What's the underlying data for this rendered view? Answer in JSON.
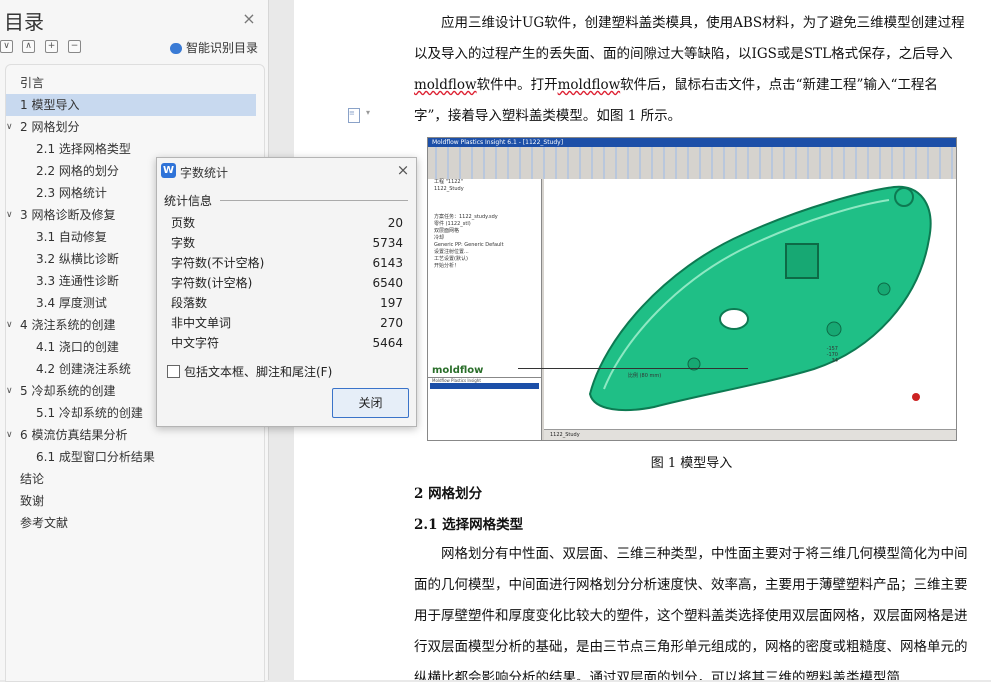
{
  "toc": {
    "title": "目录",
    "close_glyph": "×",
    "tools": [
      "∨",
      "∧",
      "+",
      "−"
    ],
    "smart_label": "智能识别目录",
    "items": [
      {
        "label": "引言",
        "level": 1,
        "caret": ""
      },
      {
        "label": "1 模型导入",
        "level": 1,
        "caret": "",
        "selected": true
      },
      {
        "label": "2 网格划分",
        "level": 1,
        "caret": "∨"
      },
      {
        "label": "2.1  选择网格类型",
        "level": 2,
        "caret": ""
      },
      {
        "label": "2.2 网格的划分",
        "level": 2,
        "caret": ""
      },
      {
        "label": "2.3 网格统计",
        "level": 2,
        "caret": ""
      },
      {
        "label": "3 网格诊断及修复",
        "level": 1,
        "caret": "∨"
      },
      {
        "label": "3.1 自动修复",
        "level": 2,
        "caret": ""
      },
      {
        "label": "3.2 纵横比诊断",
        "level": 2,
        "caret": ""
      },
      {
        "label": "3.3 连通性诊断",
        "level": 2,
        "caret": ""
      },
      {
        "label": "3.4 厚度测试",
        "level": 2,
        "caret": ""
      },
      {
        "label": "4 浇注系统的创建",
        "level": 1,
        "caret": "∨"
      },
      {
        "label": "4.1 浇口的创建",
        "level": 2,
        "caret": ""
      },
      {
        "label": "4.2 创建浇注系统",
        "level": 2,
        "caret": ""
      },
      {
        "label": "5 冷却系统的创建",
        "level": 1,
        "caret": "∨"
      },
      {
        "label": "5.1 冷却系统的创建",
        "level": 2,
        "caret": ""
      },
      {
        "label": "6 模流仿真结果分析",
        "level": 1,
        "caret": "∨"
      },
      {
        "label": "6.1 成型窗口分析结果",
        "level": 2,
        "caret": ""
      },
      {
        "label": "结论",
        "level": 1,
        "caret": ""
      },
      {
        "label": "致谢",
        "level": 1,
        "caret": ""
      },
      {
        "label": "参考文献",
        "level": 1,
        "caret": ""
      }
    ]
  },
  "document": {
    "para1": {
      "a": "应用三维设计UG软件，创建塑料盖类模具，使用ABS材料，为了避免三维模型创建过程以及导入的过程产生的丢失面、面的间隙过大等缺陷，以IGS或是STL格式保存，之后导入",
      "b": "moldflow",
      "c": "软件中。打开",
      "d": "moldflow",
      "e": "软件后，鼠标右击文件，点击“新建工程”输入“工程名字”，接着导入塑料盖类模型。如图 1 所示。"
    },
    "figure": {
      "titlebar": "Moldflow Plastics Insight 6.1 - [1122_Study]",
      "tree_lines": [
        "工程 \"1122\"",
        "1122_Study",
        "",
        "",
        "",
        "方案任务：1122_study.sdy",
        "零件 (1122_stl)",
        "双层面网格",
        "冷却",
        "Generic PP: Generic Default",
        "设置注射位置...",
        "工艺设置(默认)",
        "开始分析！"
      ],
      "tab": "1122_Study",
      "logo": "moldflow",
      "logo_sub": "Moldflow Plastics Insight",
      "scale_label": "比例 (80 mm)",
      "coords": [
        "-157",
        "-170",
        "34"
      ],
      "part_color": "#1fbf86"
    },
    "caption": "图 1  模型导入",
    "heading1": "2 网格划分",
    "heading2": "2.1  选择网格类型",
    "para2": "网格划分有中性面、双层面、三维三种类型，中性面主要对于将三维几何模型简化为中间面的几何模型，中间面进行网格划分分析速度快、效率高，主要用于薄壁塑料产品；三维主要用于厚壁塑件和厚度变化比较大的塑件，这个塑料盖类选择使用双层面网格，双层面网格是进行双层面模型分析的基础，是由三节点三角形单元组成的，网格的密度或粗糙度、网格单元的纵横比都会影响分析的结果。通过双层面的划分，可以将其三维的塑料盖类模型简"
  },
  "dialog": {
    "logo": "W",
    "title": "字数统计",
    "close_glyph": "×",
    "section": "统计信息",
    "stats": [
      {
        "label": "页数",
        "value": "20"
      },
      {
        "label": "字数",
        "value": "5734"
      },
      {
        "label": "字符数(不计空格)",
        "value": "6143"
      },
      {
        "label": "字符数(计空格)",
        "value": "6540"
      },
      {
        "label": "段落数",
        "value": "197"
      },
      {
        "label": "非中文单词",
        "value": "270"
      },
      {
        "label": "中文字符",
        "value": "5464"
      }
    ],
    "checkbox_label": "包括文本框、脚注和尾注(F)",
    "checkbox_checked": false,
    "close_button": "关闭"
  }
}
